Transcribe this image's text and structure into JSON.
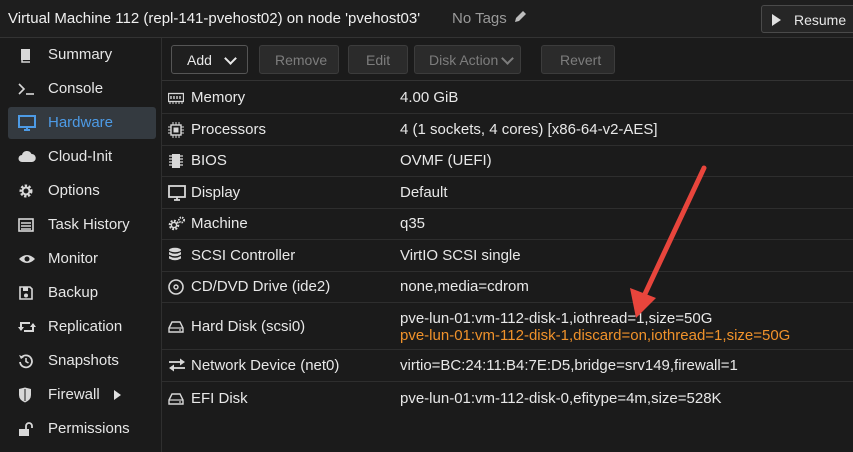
{
  "header": {
    "title": "Virtual Machine 112 (repl-141-pvehost02) on node 'pvehost03'",
    "tags": "No Tags",
    "resume_label": "Resume"
  },
  "sidebar": {
    "items": [
      {
        "label": "Summary",
        "icon": "book-icon"
      },
      {
        "label": "Console",
        "icon": "terminal-icon"
      },
      {
        "label": "Hardware",
        "icon": "desktop-icon",
        "active": true
      },
      {
        "label": "Cloud-Init",
        "icon": "cloud-icon"
      },
      {
        "label": "Options",
        "icon": "gear-icon"
      },
      {
        "label": "Task History",
        "icon": "list-icon"
      },
      {
        "label": "Monitor",
        "icon": "eye-icon"
      },
      {
        "label": "Backup",
        "icon": "floppy-icon"
      },
      {
        "label": "Replication",
        "icon": "retweet-icon"
      },
      {
        "label": "Snapshots",
        "icon": "history-icon"
      },
      {
        "label": "Firewall",
        "icon": "shield-icon"
      },
      {
        "label": "Permissions",
        "icon": "unlock-icon"
      }
    ]
  },
  "toolbar": {
    "add": "Add",
    "remove": "Remove",
    "edit": "Edit",
    "disk_action": "Disk Action",
    "revert": "Revert"
  },
  "hardware": {
    "rows": [
      {
        "key": "Memory",
        "value": "4.00 GiB",
        "icon": "memory-icon"
      },
      {
        "key": "Processors",
        "value": "4 (1 sockets, 4 cores) [x86-64-v2-AES]",
        "icon": "cpu-icon"
      },
      {
        "key": "BIOS",
        "value": "OVMF (UEFI)",
        "icon": "microchip-icon"
      },
      {
        "key": "Display",
        "value": "Default",
        "icon": "monitor-icon"
      },
      {
        "key": "Machine",
        "value": "q35",
        "icon": "cogs-icon"
      },
      {
        "key": "SCSI Controller",
        "value": "VirtIO SCSI single",
        "icon": "database-icon"
      },
      {
        "key": "CD/DVD Drive (ide2)",
        "value": "none,media=cdrom",
        "icon": "cdrom-icon"
      },
      {
        "key": "Hard Disk (scsi0)",
        "value": "pve-lun-01:vm-112-disk-1,iothread=1,size=50G",
        "pending": "pve-lun-01:vm-112-disk-1,discard=on,iothread=1,size=50G",
        "icon": "hdd-icon"
      },
      {
        "key": "Network Device (net0)",
        "value": "virtio=BC:24:11:B4:7E:D5,bridge=srv149,firewall=1",
        "icon": "exchange-icon"
      },
      {
        "key": "EFI Disk",
        "value": "pve-lun-01:vm-112-disk-0,efitype=4m,size=528K",
        "icon": "hdd-icon"
      }
    ]
  },
  "colors": {
    "accent": "#4d9be6",
    "pending": "#f0922b",
    "annotation_arrow": "#e8453c"
  }
}
